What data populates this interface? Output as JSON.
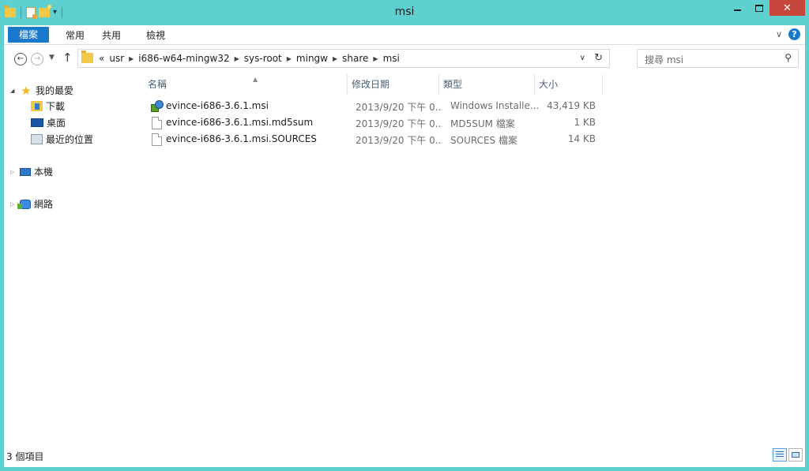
{
  "window": {
    "title": "msi",
    "close_glyph": "✕",
    "min_glyph": "",
    "max_glyph": ""
  },
  "ribbon": {
    "tabs": [
      {
        "label": "檔案"
      },
      {
        "label": "常用"
      },
      {
        "label": "共用"
      },
      {
        "label": "檢視"
      }
    ],
    "expand_glyph": "∨",
    "help_glyph": "?"
  },
  "address": {
    "back_glyph": "←",
    "forward_glyph": "→",
    "dropdown_glyph": "▼",
    "up_glyph": "↑",
    "overflow": "«",
    "crumbs": [
      "usr",
      "i686-w64-mingw32",
      "sys-root",
      "mingw",
      "share",
      "msi"
    ],
    "crumb_sep": "▶",
    "history_glyph": "∨",
    "refresh_glyph": "↻"
  },
  "search": {
    "placeholder": "搜尋 msi",
    "icon_glyph": "⚲"
  },
  "nav": {
    "favorites": {
      "label": "我的最愛",
      "expander": "◢",
      "star": "★"
    },
    "favorites_items": [
      {
        "label": "下載"
      },
      {
        "label": "桌面"
      },
      {
        "label": "最近的位置"
      }
    ],
    "this_pc": {
      "label": "本機",
      "expander": "▷"
    },
    "network": {
      "label": "網路",
      "expander": "▷"
    }
  },
  "columns": {
    "name": "名稱",
    "date": "修改日期",
    "type": "類型",
    "size": "大小",
    "sort_glyph": "▲"
  },
  "files": [
    {
      "name": "evince-i686-3.6.1.msi",
      "date": "2013/9/20 下午 0...",
      "type": "Windows Installe...",
      "size": "43,419 KB",
      "icon": "msi-installer-icon"
    },
    {
      "name": "evince-i686-3.6.1.msi.md5sum",
      "date": "2013/9/20 下午 0...",
      "type": "MD5SUM 檔案",
      "size": "1 KB",
      "icon": "file-icon"
    },
    {
      "name": "evince-i686-3.6.1.msi.SOURCES",
      "date": "2013/9/20 下午 0...",
      "type": "SOURCES 檔案",
      "size": "14 KB",
      "icon": "file-icon"
    }
  ],
  "status": {
    "item_count": "3 個項目"
  },
  "colors": {
    "frame": "#5fd0d0",
    "file_tab": "#1979ca",
    "close_button": "#c7463c"
  }
}
